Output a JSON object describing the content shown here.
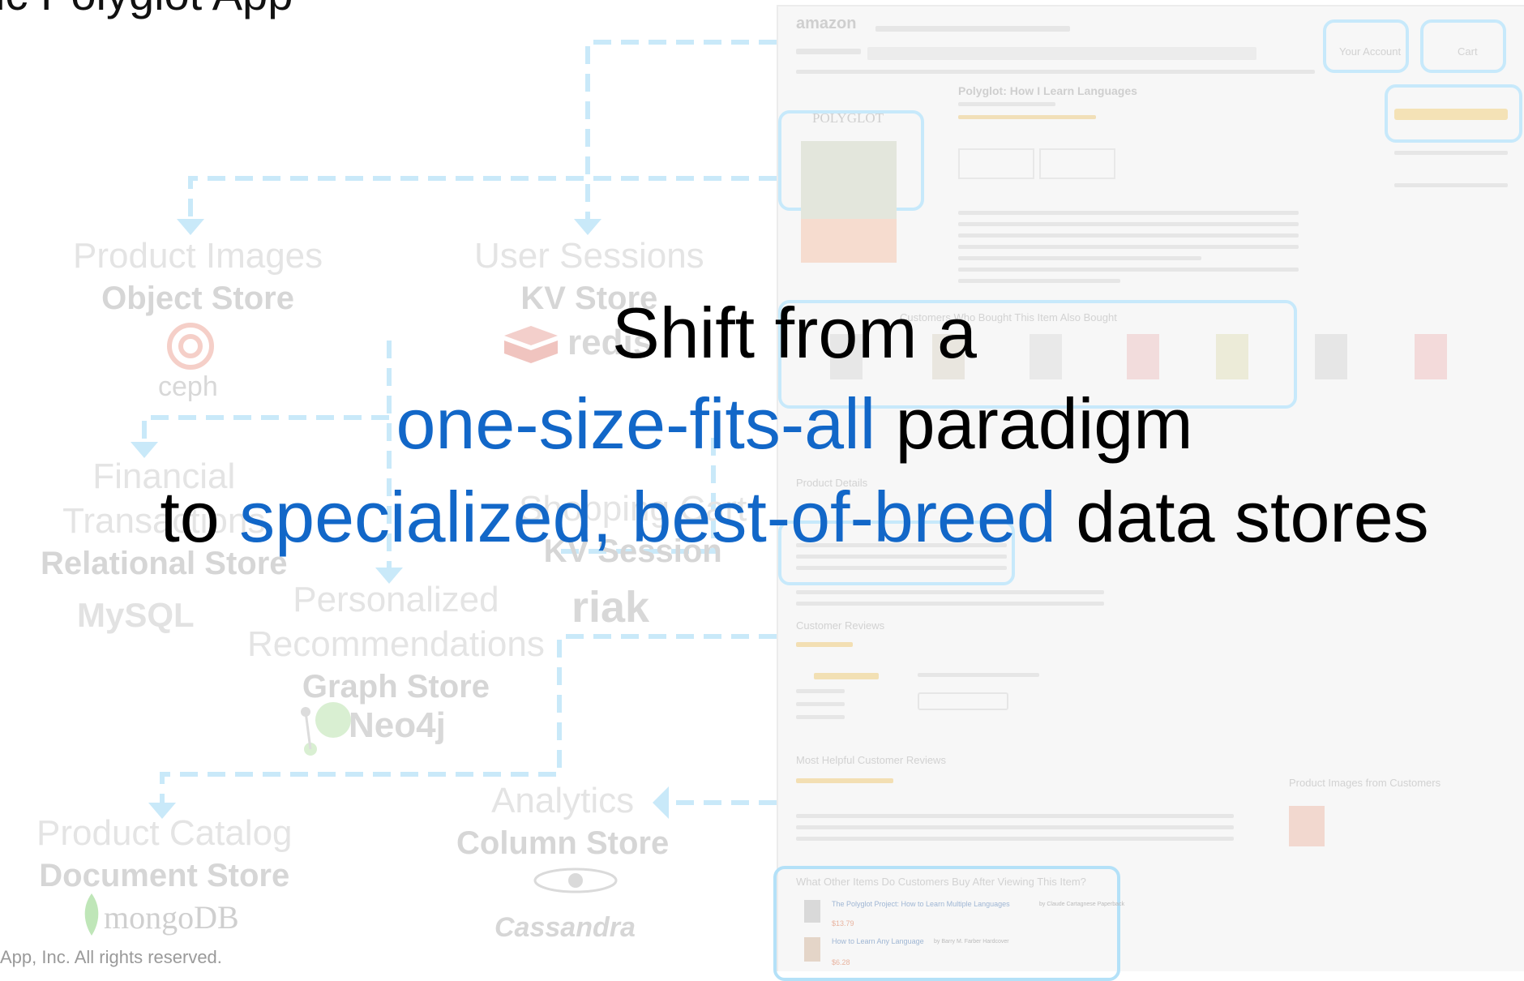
{
  "slide": {
    "title_fragment": "ic Polyglot App",
    "footer": "App, Inc. All rights reserved."
  },
  "stores": [
    {
      "title": "Product Images",
      "store": "Object Store",
      "logo": "ceph"
    },
    {
      "title": "User Sessions",
      "store": "KV Store",
      "logo": "redis"
    },
    {
      "title_line1": "Financial",
      "title_line2": "Transactions",
      "store": "Relational Store",
      "logo": "MySQL"
    },
    {
      "title": "Shopping Cart",
      "store": "KV Session",
      "logo": "riak"
    },
    {
      "title_line1": "Personalized",
      "title_line2": "Recommendations",
      "store": "Graph Store",
      "logo": "Neo4j"
    },
    {
      "title": "Product Catalog",
      "store": "Document Store",
      "logo": "mongoDB"
    },
    {
      "title": "Analytics",
      "store": "Column Store",
      "logo": "Cassandra"
    }
  ],
  "headline": {
    "line1": "Shift from a",
    "line2_blue": "one-size-fits-all",
    "line2_black": " paradigm",
    "line3_prefix": "to ",
    "line3_blue": "specialized, best-of-breed",
    "line3_suffix": " data stores"
  },
  "screenshot": {
    "logo": "amazon",
    "account_label": "Your Account",
    "cart_label": "Cart",
    "book_title": "Polyglot: How I Learn Languages",
    "book_cover_text": "POLYGLOT",
    "recent_header": "Customers Who Bought This Item Also Bought",
    "product_details": "Product Details",
    "reviews_header": "Customer Reviews",
    "helpful_header": "Most Helpful Customer Reviews",
    "product_images_header": "Product Images from Customers",
    "also_viewed_header": "What Other Items Do Customers Buy After Viewing This Item?",
    "item1_title": "The Polyglot Project: How to Learn Multiple Languages",
    "item1_author": "by Claude Cartagnese  Paperback",
    "item1_price": "$13.79",
    "item2_title": "How to Learn Any Language",
    "item2_author": "by Barry M. Farber  Hardcover",
    "item2_price": "$6.28"
  },
  "colors": {
    "headline_blue": "#1267c8",
    "connector_blue": "#c9e9f9",
    "highlight_blue": "#c7e9fb",
    "faded_text": "#dedede"
  }
}
